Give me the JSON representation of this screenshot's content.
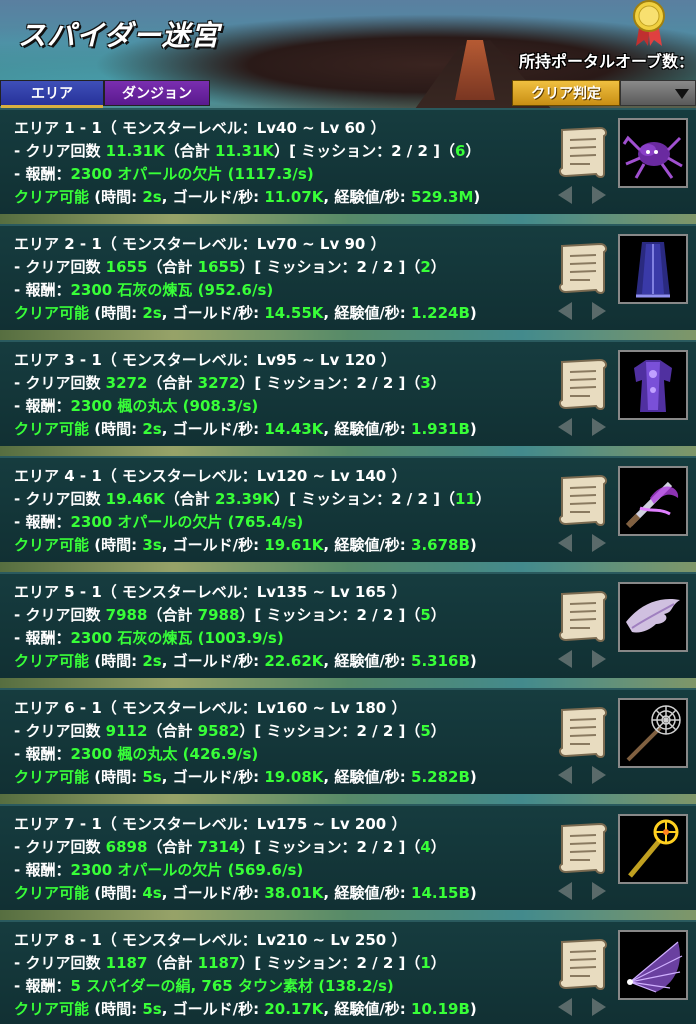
{
  "header": {
    "title": "スパイダー迷宮",
    "orb_label": "所持ポータルオーブ数：",
    "tab_area": "エリア",
    "tab_dungeon": "ダンジョン",
    "clear_button": "クリア判定"
  },
  "labels": {
    "clear_count_prefix": "- クリア回数 ",
    "total_open": "（合計 ",
    "mission_close": "）[ ミッション：2 / 2 ]（",
    "close_paren": "）",
    "reward_prefix": "- 報酬：",
    "clearable": "クリア可能",
    "time_prefix": " (時間: ",
    "gold_prefix": ", ゴールド/秒: ",
    "exp_prefix": ", 経験値/秒: ",
    "end_paren": ")"
  },
  "areas": [
    {
      "title": "エリア 1 - 1（ モンスターレベル：Lv40 ~ Lv 60 ）",
      "clears": "11.31K",
      "total": "11.31K",
      "missions": "6",
      "reward": "2300 オパールの欠片",
      "rate": "(1117.3/s)",
      "time": "2s",
      "gold": "11.07K",
      "exp": "529.3M",
      "item_icon": "spider-icon"
    },
    {
      "title": "エリア 2 - 1（ モンスターレベル：Lv70 ~ Lv 90 ）",
      "clears": "1655",
      "total": "1655",
      "missions": "2",
      "reward": "2300 石灰の煉瓦",
      "rate": "(952.6/s)",
      "time": "2s",
      "gold": "14.55K",
      "exp": "1.224B",
      "item_icon": "cape-icon"
    },
    {
      "title": "エリア 3 - 1（ モンスターレベル：Lv95 ~ Lv 120 ）",
      "clears": "3272",
      "total": "3272",
      "missions": "3",
      "reward": "2300 楓の丸太",
      "rate": "(908.3/s)",
      "time": "2s",
      "gold": "14.43K",
      "exp": "1.931B",
      "item_icon": "robe-icon"
    },
    {
      "title": "エリア 4 - 1（ モンスターレベル：Lv120 ~ Lv 140 ）",
      "clears": "19.46K",
      "total": "23.39K",
      "missions": "11",
      "reward": "2300 オパールの欠片",
      "rate": "(765.4/s)",
      "time": "3s",
      "gold": "19.61K",
      "exp": "3.678B",
      "item_icon": "sword-icon"
    },
    {
      "title": "エリア 5 - 1（ モンスターレベル：Lv135 ~ Lv 165 ）",
      "clears": "7988",
      "total": "7988",
      "missions": "5",
      "reward": "2300 石灰の煉瓦",
      "rate": "(1003.9/s)",
      "time": "2s",
      "gold": "22.62K",
      "exp": "5.316B",
      "item_icon": "wing-icon"
    },
    {
      "title": "エリア 6 - 1（ モンスターレベル：Lv160 ~ Lv 180 ）",
      "clears": "9112",
      "total": "9582",
      "missions": "5",
      "reward": "2300 楓の丸太",
      "rate": "(426.9/s)",
      "time": "5s",
      "gold": "19.08K",
      "exp": "5.282B",
      "item_icon": "web-staff-icon"
    },
    {
      "title": "エリア 7 - 1（ モンスターレベル：Lv175 ~ Lv 200 ）",
      "clears": "6898",
      "total": "7314",
      "missions": "4",
      "reward": "2300 オパールの欠片",
      "rate": "(569.6/s)",
      "time": "4s",
      "gold": "38.01K",
      "exp": "14.15B",
      "item_icon": "golden-staff-icon"
    },
    {
      "title": "エリア 8 - 1（ モンスターレベル：Lv210 ~ Lv 250 ）",
      "clears": "1187",
      "total": "1187",
      "missions": "1",
      "reward": "5 スパイダーの絹, 765 タウン素材",
      "rate": "(138.2/s)",
      "time": "5s",
      "gold": "20.17K",
      "exp": "10.19B",
      "item_icon": "fan-icon"
    }
  ]
}
